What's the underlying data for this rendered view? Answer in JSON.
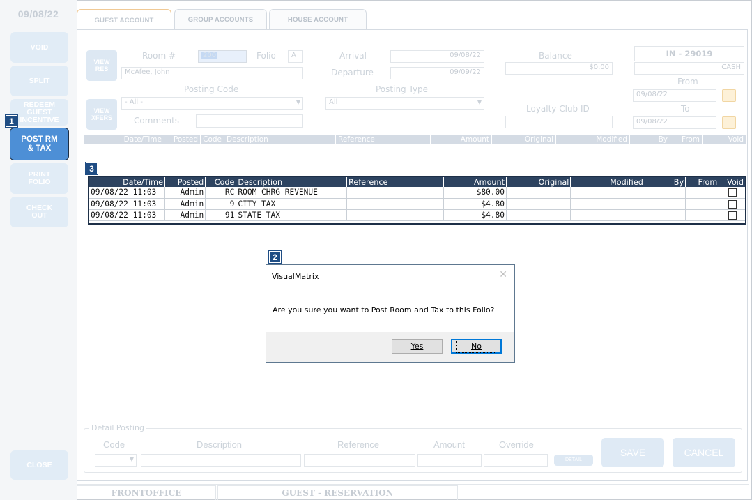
{
  "sidebar": {
    "date": "09/08/22",
    "buttons": {
      "void": "VOID",
      "split": "SPLIT",
      "redeem": "REDEEM\nGUEST\nINCENTIVE",
      "post_rm_tax": "POST RM\n& TAX",
      "print_folio": "PRINT\nFOLIO",
      "check_out": "CHECK\nOUT",
      "close": "CLOSE"
    }
  },
  "tabs": [
    "GUEST ACCOUNT",
    "GROUP ACCOUNTS",
    "HOUSE ACCOUNT"
  ],
  "markers": [
    "1",
    "2",
    "3"
  ],
  "form": {
    "view_res": "VIEW\nRES",
    "view_xfers": "VIEW\nXFERS",
    "room_label": "Room #",
    "room_value": "200",
    "folio_label": "Folio",
    "folio_value": "A",
    "guest_name": "McAfee, John",
    "posting_code_label": "Posting Code",
    "posting_code_value": "- All -",
    "comments_label": "Comments",
    "arrival_label": "Arrival",
    "arrival_value": "09/08/22",
    "departure_label": "Departure",
    "departure_value": "09/09/22",
    "posting_type_label": "Posting Type",
    "posting_type_value": "All",
    "balance_label": "Balance",
    "balance_value": "$0.00",
    "loyalty_label": "Loyalty Club ID",
    "account_id": "IN - 29019",
    "payment": "CASH",
    "from_label": "From",
    "from_value": "09/08/22",
    "to_label": "To",
    "to_value": "09/08/22"
  },
  "faded_header": [
    "Date/Time",
    "Posted",
    "Code",
    "Description",
    "Reference",
    "Amount",
    "Original",
    "Modified",
    "By",
    "From",
    "Void"
  ],
  "grid": {
    "headers": [
      "Date/Time",
      "Posted",
      "Code",
      "Description",
      "Reference",
      "Amount",
      "Original",
      "Modified",
      "By",
      "From",
      "Void"
    ],
    "rows": [
      {
        "datetime": "09/08/22 11:03",
        "posted": "Admin",
        "code": "RC",
        "description": "ROOM CHRG REVENUE",
        "reference": "",
        "amount": "$80.00"
      },
      {
        "datetime": "09/08/22 11:03",
        "posted": "Admin",
        "code": "9",
        "description": "CITY TAX",
        "reference": "",
        "amount": "$4.80"
      },
      {
        "datetime": "09/08/22 11:03",
        "posted": "Admin",
        "code": "91",
        "description": "STATE TAX",
        "reference": "",
        "amount": "$4.80"
      }
    ]
  },
  "dialog": {
    "title": "VisualMatrix",
    "message": "Are you sure you want to Post Room and Tax to this Folio?",
    "yes_label": "Yes",
    "no_label": "No"
  },
  "detail": {
    "legend": "Detail Posting",
    "code": "Code",
    "description": "Description",
    "reference": "Reference",
    "amount": "Amount",
    "override": "Override",
    "detail_btn": "DETAIL",
    "save": "SAVE",
    "cancel": "CANCEL"
  },
  "bottom_tabs": [
    "FRONTOFFICE",
    "GUEST - RESERVATION"
  ]
}
